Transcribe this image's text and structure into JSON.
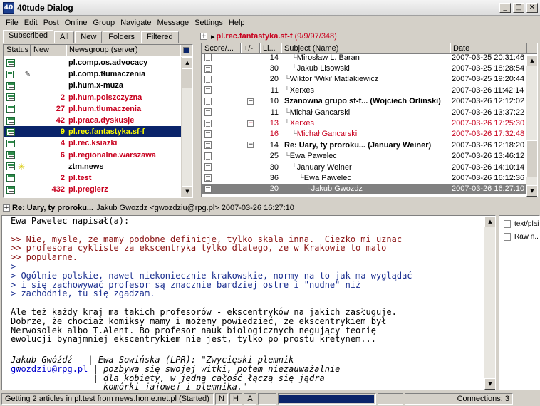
{
  "window": {
    "title": "40tude Dialog",
    "icon": "app-icon",
    "buttons": [
      "_",
      "□",
      "✕"
    ]
  },
  "menu": [
    "File",
    "Edit",
    "Post",
    "Online",
    "Group",
    "Navigate",
    "Message",
    "Settings",
    "Help"
  ],
  "groups_pane": {
    "tabs": [
      "Subscribed",
      "All",
      "New",
      "Folders",
      "Filtered"
    ],
    "columns": [
      "Status",
      "New",
      "Newsgroup (server)"
    ],
    "rows": [
      {
        "new": "",
        "name": "pl.comp.os.advocacy",
        "state": "normal",
        "extra": ""
      },
      {
        "new": "",
        "name": "pl.comp.tłumaczenia",
        "state": "normal",
        "extra": "microphone-icon"
      },
      {
        "new": "",
        "name": "pl.hum.x-muza",
        "state": "normal",
        "extra": ""
      },
      {
        "new": "2",
        "name": "pl.hum.polszczyzna",
        "state": "red",
        "extra": ""
      },
      {
        "new": "27",
        "name": "pl.hum.tlumaczenia",
        "state": "red",
        "extra": ""
      },
      {
        "new": "42",
        "name": "pl.praca.dyskusje",
        "state": "red",
        "extra": ""
      },
      {
        "new": "9",
        "name": "pl.rec.fantastyka.sf-f",
        "state": "selected",
        "extra": ""
      },
      {
        "new": "4",
        "name": "pl.rec.ksiazki",
        "state": "red",
        "extra": ""
      },
      {
        "new": "6",
        "name": "pl.regionalne.warszawa",
        "state": "red",
        "extra": ""
      },
      {
        "new": "",
        "name": "ztm.news",
        "state": "normal",
        "extra": "sun-icon"
      },
      {
        "new": "2",
        "name": "pl.test",
        "state": "red",
        "extra": ""
      },
      {
        "new": "432",
        "name": "pl.pregierz",
        "state": "red",
        "extra": ""
      }
    ]
  },
  "articles_pane": {
    "header_group": "pl.rec.fantastyka.sf-f",
    "header_counts": "(9/9/97/348)",
    "columns": [
      "Score/...",
      "+/-",
      "Li...",
      "Subject (Name)",
      "Date"
    ],
    "rows": [
      {
        "lines": "14",
        "subject": "Mirosław L. Baran",
        "date": "2007-03-25 20:31:46",
        "indent": 2,
        "style": "normal",
        "toggle": ""
      },
      {
        "lines": "30",
        "subject": "Jakub Lisowski",
        "date": "2007-03-25 18:28:54",
        "indent": 2,
        "style": "normal",
        "toggle": ""
      },
      {
        "lines": "20",
        "subject": "Wiktor 'Wiki' Matlakiewicz",
        "date": "2007-03-25 19:20:44",
        "indent": 1,
        "style": "normal",
        "toggle": ""
      },
      {
        "lines": "11",
        "subject": "Xerxes",
        "date": "2007-03-26 11:42:14",
        "indent": 1,
        "style": "normal",
        "toggle": ""
      },
      {
        "lines": "10",
        "subject": "Szanowna grupo sf-f... (Wojciech Orlinski)",
        "date": "2007-03-26 12:12:02",
        "indent": 0,
        "style": "bold",
        "toggle": "−"
      },
      {
        "lines": "11",
        "subject": "Michał Gancarski",
        "date": "2007-03-26 13:37:22",
        "indent": 1,
        "style": "normal",
        "toggle": ""
      },
      {
        "lines": "13",
        "subject": "Xerxes",
        "date": "2007-03-26 17:25:30",
        "indent": 1,
        "style": "red",
        "toggle": "−"
      },
      {
        "lines": "16",
        "subject": "Michał Gancarski",
        "date": "2007-03-26 17:32:48",
        "indent": 2,
        "style": "red",
        "toggle": ""
      },
      {
        "lines": "14",
        "subject": "Re: Uary, ty proroku... (January Weiner)",
        "date": "2007-03-26 12:18:20",
        "indent": 0,
        "style": "bold",
        "toggle": "−"
      },
      {
        "lines": "25",
        "subject": "Ewa Pawelec",
        "date": "2007-03-26 13:46:12",
        "indent": 1,
        "style": "normal",
        "toggle": ""
      },
      {
        "lines": "30",
        "subject": "January Weiner",
        "date": "2007-03-26 14:10:14",
        "indent": 2,
        "style": "normal",
        "toggle": ""
      },
      {
        "lines": "36",
        "subject": "Ewa Pawelec",
        "date": "2007-03-26 16:12:36",
        "indent": 3,
        "style": "normal",
        "toggle": ""
      },
      {
        "lines": "20",
        "subject": "Jakub Gwozdz",
        "date": "2007-03-26 16:27:10",
        "indent": 4,
        "style": "selected",
        "toggle": ""
      }
    ]
  },
  "message_header": {
    "subject": "Re: Uary, ty proroku...",
    "from": "Jakub Gwozdz <gwozdziu@rpg.pl> 2007-03-26 16:27:10"
  },
  "message_body": [
    {
      "text": "Ewa Pawelec napisał(a):",
      "style": "normal"
    },
    {
      "text": "",
      "style": "normal"
    },
    {
      "text": ">> Nie, mysle, ze mamy podobne definicje, tylko skala inna.  Ciezko mi uznac",
      "style": "q1"
    },
    {
      "text": ">> profesora cykliste za ekscentryka tylko dlatego, ze w Krakowie to malo",
      "style": "q1"
    },
    {
      "text": ">> popularne.",
      "style": "q1"
    },
    {
      "text": ">",
      "style": "q2"
    },
    {
      "text": "> Ogólnie polskie, nawet niekoniecznie krakowskie, normy na to jak ma wyglądać",
      "style": "q2"
    },
    {
      "text": "> i się zachowywać profesor są znacznie bardziej ostre i \"nudne\" niż",
      "style": "q2"
    },
    {
      "text": "> zachodnie, tu się zgadzam.",
      "style": "q2"
    },
    {
      "text": "",
      "style": "normal"
    },
    {
      "text": "Ale też każdy kraj ma takich profesorów - ekscentryków na jakich zasługuje.",
      "style": "normal"
    },
    {
      "text": "Dobrze, że chociaż komiksy mamy i możemy powiedzieć, że ekscentrykiem był",
      "style": "normal"
    },
    {
      "text": "Nerwosolek albo T.Alent. Bo profesor nauk biologicznych negujący teorię",
      "style": "normal"
    },
    {
      "text": "ewolucji bynajmniej ekscentrykiem nie jest, tylko po prostu kretynem...",
      "style": "normal"
    },
    {
      "text": "",
      "style": "normal"
    },
    {
      "text": "",
      "style": "normal"
    },
    {
      "text": "--",
      "style": "normal"
    }
  ],
  "signature": {
    "name": "Jakub Gwóźdź",
    "email": "gwozdziu@rpg.pl",
    "quote_lines": [
      "Ewa Sowińska (LPR): \"Zwycięski plemnik",
      "pozbywa się swojej witki, potem niezauważalnie",
      "dla kobiety, w jedną całość łączą się jądra",
      "komórki jajowej i plemnika.\""
    ]
  },
  "side_pane": {
    "items": [
      "text/plain",
      "Raw n..."
    ]
  },
  "statusbar": {
    "message": "Getting 2 articles in pl.test from news.home.net.pl (Started)",
    "flags": [
      "N",
      "H",
      "A"
    ],
    "connections": "Connections: 3"
  }
}
